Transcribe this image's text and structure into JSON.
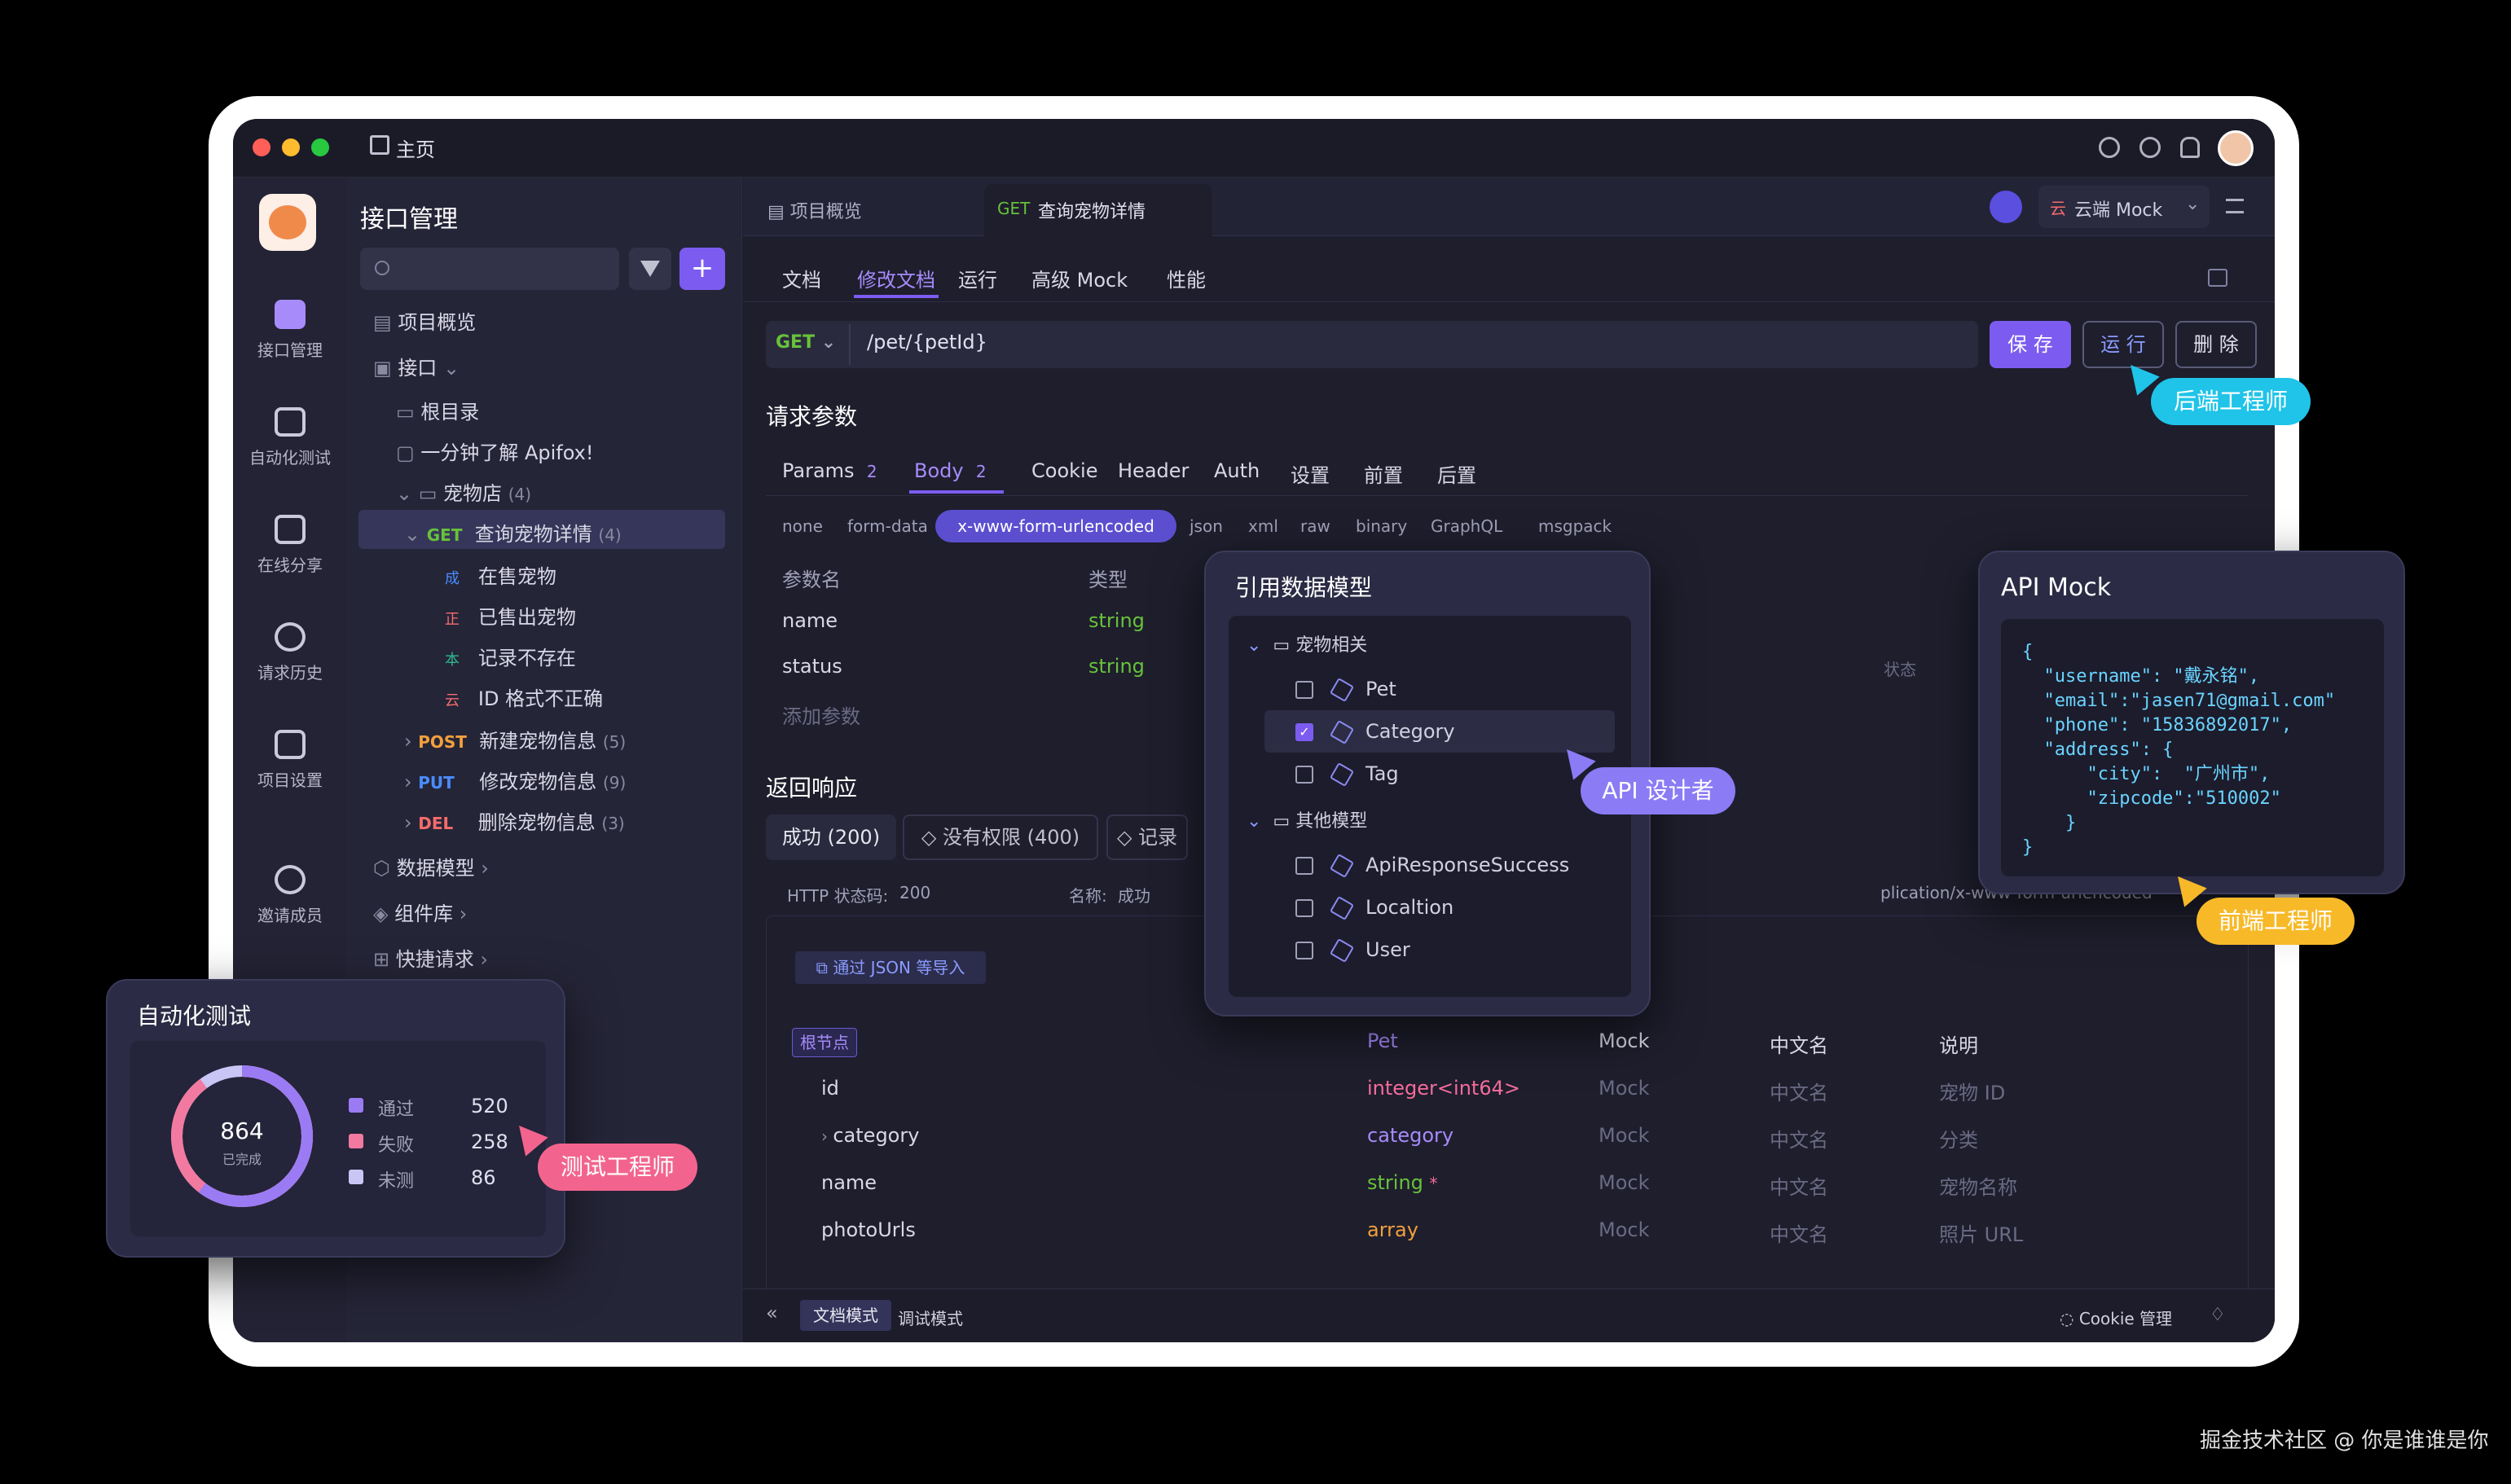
{
  "title": {
    "home": "主页"
  },
  "sidebar": {
    "items": [
      {
        "label": "接口管理"
      },
      {
        "label": "自动化测试"
      },
      {
        "label": "在线分享"
      },
      {
        "label": "请求历史"
      },
      {
        "label": "项目设置"
      },
      {
        "label": "邀请成员"
      }
    ]
  },
  "tree": {
    "heading": "接口管理",
    "rows": [
      {
        "label": "项目概览"
      },
      {
        "label": "接口"
      },
      {
        "label": "根目录"
      },
      {
        "label": "一分钟了解 Apifox!"
      },
      {
        "label": "宠物店",
        "count": "(4)"
      },
      {
        "method": "GET",
        "label": "查询宠物详情",
        "count": "(4)"
      },
      {
        "tag": "成",
        "label": "在售宠物"
      },
      {
        "tag": "正",
        "label": "已售出宠物"
      },
      {
        "tag": "本",
        "label": "记录不存在"
      },
      {
        "tag": "云",
        "label": "ID 格式不正确"
      },
      {
        "method": "POST",
        "label": "新建宠物信息",
        "count": "(5)"
      },
      {
        "method": "PUT",
        "label": "修改宠物信息",
        "count": "(9)"
      },
      {
        "method": "DEL",
        "label": "删除宠物信息",
        "count": "(3)"
      },
      {
        "label": "数据模型"
      },
      {
        "label": "组件库"
      },
      {
        "label": "快捷请求"
      }
    ]
  },
  "main": {
    "tabs": [
      {
        "label": "项目概览"
      },
      {
        "method": "GET",
        "label": "查询宠物详情"
      }
    ],
    "env": "云端 Mock",
    "subtabs": [
      {
        "label": "文档"
      },
      {
        "label": "修改文档"
      },
      {
        "label": "运行"
      },
      {
        "label": "高级 Mock"
      },
      {
        "label": "性能"
      }
    ],
    "method": "GET",
    "url": "/pet/{petId}",
    "buttons": {
      "save": "保 存",
      "run": "运 行",
      "delete": "删 除"
    },
    "request_title": "请求参数",
    "param_tabs": [
      {
        "label": "Params",
        "count": "2"
      },
      {
        "label": "Body",
        "count": "2"
      },
      {
        "label": "Cookie"
      },
      {
        "label": "Header"
      },
      {
        "label": "Auth"
      },
      {
        "label": "设置"
      },
      {
        "label": "前置"
      },
      {
        "label": "后置"
      }
    ],
    "body_types": [
      "none",
      "form-data",
      "x-www-form-urlencoded",
      "json",
      "xml",
      "raw",
      "binary",
      "GraphQL",
      "msgpack"
    ],
    "table_headers": {
      "name": "参数名",
      "type": "类型"
    },
    "params": [
      {
        "name": "name",
        "type": "string"
      },
      {
        "name": "status",
        "type": "string"
      }
    ],
    "add_param": "添加参数",
    "status_col": "状态",
    "response_title": "返回响应",
    "response_tabs": [
      {
        "label": "成功 (200)"
      },
      {
        "label": "没有权限 (400)"
      },
      {
        "label": "记录"
      }
    ],
    "http_status_label": "HTTP 状态码:",
    "http_status": "200",
    "name_label": "名称:",
    "name_value": "成功",
    "content_type": "plication/x-www-form-urlencoded",
    "import_btn": "通过 JSON 等导入",
    "schema_headers": {
      "root": "根节点",
      "type": "Pet",
      "mock": "Mock",
      "cn": "中文名",
      "desc": "说明"
    },
    "schema_rows": [
      {
        "name": "id",
        "type": "integer<int64>",
        "mock": "Mock",
        "cn": "中文名",
        "desc": "宠物 ID"
      },
      {
        "name": "category",
        "type": "category",
        "mock": "Mock",
        "cn": "中文名",
        "desc": "分类"
      },
      {
        "name": "name",
        "type": "string",
        "mock": "Mock",
        "cn": "中文名",
        "desc": "宠物名称"
      },
      {
        "name": "photoUrls",
        "type": "array",
        "mock": "Mock",
        "cn": "中文名",
        "desc": "照片 URL"
      }
    ],
    "footer": {
      "doc_mode": "文档模式",
      "debug_mode": "调试模式",
      "cookie": "Cookie 管理"
    }
  },
  "model_popup": {
    "title": "引用数据模型",
    "groups": [
      {
        "label": "宠物相关",
        "items": [
          {
            "label": "Pet",
            "checked": false
          },
          {
            "label": "Category",
            "checked": true
          },
          {
            "label": "Tag",
            "checked": false
          }
        ]
      },
      {
        "label": "其他模型",
        "items": [
          {
            "label": "ApiResponseSuccess",
            "checked": false
          },
          {
            "label": "Localtion",
            "checked": false
          },
          {
            "label": "User",
            "checked": false
          }
        ]
      }
    ]
  },
  "mock_popup": {
    "title": "API Mock",
    "code": "{\n  \"username\": \"戴永铭\",\n  \"email\":\"jasen71@gmail.com\"\n  \"phone\": \"15836892017\",\n  \"address\": {\n      \"city\":  \"广州市\",\n      \"zipcode\":\"510002\"\n    }\n}"
  },
  "auto_popup": {
    "title": "自动化测试",
    "total": "864",
    "total_label": "已完成",
    "legend": [
      {
        "label": "通过",
        "value": "520",
        "color": "#9b7bf4"
      },
      {
        "label": "失败",
        "value": "258",
        "color": "#f27aa0"
      },
      {
        "label": "未测",
        "value": "86",
        "color": "#c9c6f6"
      }
    ]
  },
  "badges": {
    "backend": "后端工程师",
    "designer": "API 设计者",
    "frontend": "前端工程师",
    "tester": "测试工程师"
  },
  "watermark": "掘金技术社区 @ 你是谁谁是你"
}
